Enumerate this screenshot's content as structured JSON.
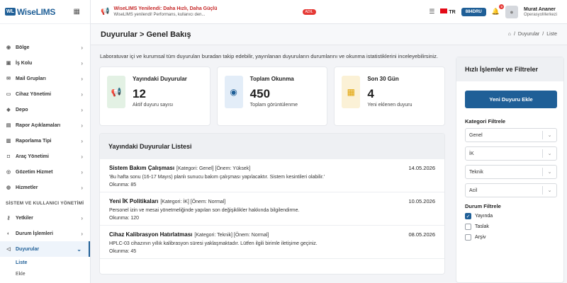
{
  "logo": {
    "badge": "WL",
    "text": "WiseLIMS"
  },
  "announcement": {
    "title": "WiseLIMS Yenilendi: Daha Hızlı, Daha Güçlü",
    "subtitle": "WiseLIMS yenilendi! Performans, kullanıcı den...",
    "badge": "ADIL"
  },
  "topbar": {
    "lang": "TR",
    "counter": "884DRU",
    "notifications": "9",
    "user_name": "Murat Ananer",
    "user_role": "OperasyoMerkezi"
  },
  "sidebar": {
    "items": [
      {
        "label": "Bölge",
        "icon": "location-icon"
      },
      {
        "label": "İş Kolu",
        "icon": "briefcase-icon"
      },
      {
        "label": "Mail Grupları",
        "icon": "mail-icon"
      },
      {
        "label": "Cihaz Yönetimi",
        "icon": "device-icon"
      },
      {
        "label": "Depo",
        "icon": "warehouse-icon"
      },
      {
        "label": "Rapor Açıklamaları",
        "icon": "report-icon"
      },
      {
        "label": "Raporlama Tipi",
        "icon": "report-type-icon"
      },
      {
        "label": "Araç Yönetimi",
        "icon": "car-icon"
      },
      {
        "label": "Gözetim Hizmet",
        "icon": "eye-icon"
      },
      {
        "label": "Hizmetler",
        "icon": "services-icon"
      }
    ],
    "section_title": "SİSTEM VE KULLANICI YÖNETİMİ",
    "items2": [
      {
        "label": "Yetkiler",
        "icon": "key-icon"
      },
      {
        "label": "Durum İşlemleri",
        "icon": "status-icon"
      },
      {
        "label": "Duyurular",
        "icon": "megaphone-icon"
      }
    ],
    "subitems": [
      "Liste",
      "Ekle"
    ]
  },
  "page": {
    "title": "Duyurular > Genel Bakış",
    "breadcrumb": [
      "Duyurular",
      "Liste"
    ]
  },
  "intro": "Laboratuvar içi ve kurumsal tüm duyuruları buradan takip edebilir, yayınlanan duyuruların durumlarını ve okunma istatistiklerini inceleyebilirsiniz.",
  "stats": [
    {
      "label": "Yayındaki Duyurular",
      "value": "12",
      "sub": "Aktif duyuru sayısı",
      "icon": "megaphone-icon",
      "color": "#2e7d32",
      "bg": "#e3f1e4"
    },
    {
      "label": "Toplam Okunma",
      "value": "450",
      "sub": "Toplam görüntülenme",
      "icon": "eye-icon",
      "color": "#1f5f97",
      "bg": "#e3edf8"
    },
    {
      "label": "Son 30 Gün",
      "value": "4",
      "sub": "Yeni eklenen duyuru",
      "icon": "calendar-icon",
      "color": "#e0a100",
      "bg": "#fbf1d6"
    }
  ],
  "list": {
    "title": "Yayındaki Duyurular Listesi",
    "rows": [
      {
        "title": "Sistem Bakım Çalışması",
        "meta": "[Kategori: Genel] [Önem: Yüksek]",
        "date": "14.05.2026",
        "text": "'Bu hafta sonu (16-17 Mayıs) planlı sunucu bakım çalışması yapılacaktır. Sistem kesintileri olabilir.'",
        "count": "Okunma: 85"
      },
      {
        "title": "Yeni İK Politikaları",
        "meta": "[Kategori: İK] [Önem: Normal]",
        "date": "10.05.2026",
        "text": "Personel izin ve mesai yönetmeliğinde yapılan son değişiklikler hakkında bilgilendirme.",
        "count": "Okunma: 120"
      },
      {
        "title": "Cihaz Kalibrasyon Hatırlatması",
        "meta": "[Kategori: Teknik] [Önem: Normal]",
        "date": "08.05.2026",
        "text": "HPLC-03 cihazının yıllık kalibrasyon süresi yaklaşmaktadır. Lütfen ilgili birimle iletişime geçiniz.",
        "count": "Okunma: 45"
      }
    ]
  },
  "panel": {
    "title": "Hızlı İşlemler ve Filtreler",
    "new_button": "Yeni Duyuru Ekle",
    "category_label": "Kategori Filtrele",
    "categories": [
      "Genel",
      "İK",
      "Teknik",
      "Acil"
    ],
    "status_label": "Durum Filtrele",
    "statuses": [
      {
        "label": "Yayında",
        "checked": true
      },
      {
        "label": "Taslak",
        "checked": false
      },
      {
        "label": "Arşiv",
        "checked": false
      }
    ]
  }
}
